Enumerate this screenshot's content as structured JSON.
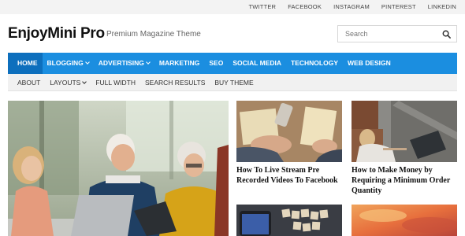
{
  "social_links": [
    "TWITTER",
    "FACEBOOK",
    "INSTAGRAM",
    "PINTEREST",
    "LINKEDIN"
  ],
  "site": {
    "title": "EnjoyMini Pro",
    "tagline": "Premium Magazine Theme"
  },
  "search": {
    "placeholder": "Search",
    "icon": "search-icon"
  },
  "main_nav": [
    {
      "label": "HOME",
      "active": true,
      "dropdown": false
    },
    {
      "label": "BLOGGING",
      "active": false,
      "dropdown": true
    },
    {
      "label": "ADVERTISING",
      "active": false,
      "dropdown": true
    },
    {
      "label": "MARKETING",
      "active": false,
      "dropdown": false
    },
    {
      "label": "SEO",
      "active": false,
      "dropdown": false
    },
    {
      "label": "SOCIAL MEDIA",
      "active": false,
      "dropdown": false
    },
    {
      "label": "TECHNOLOGY",
      "active": false,
      "dropdown": false
    },
    {
      "label": "WEB DESIGN",
      "active": false,
      "dropdown": false
    }
  ],
  "sub_nav": [
    {
      "label": "ABOUT",
      "dropdown": false
    },
    {
      "label": "LAYOUTS",
      "dropdown": true
    },
    {
      "label": "FULL WIDTH",
      "dropdown": false
    },
    {
      "label": "SEARCH RESULTS",
      "dropdown": false
    },
    {
      "label": "BUY THEME",
      "dropdown": false
    }
  ],
  "colors": {
    "nav_blue": "#1b8ee0",
    "nav_active": "#0d6fbd",
    "subnav_bg": "#f1f1f1",
    "topbar_bg": "#f3f3f3"
  },
  "posts": [
    {
      "title": "How To Live Stream Pre Recorded Videos To Facebook"
    },
    {
      "title": "How to Make Money by Requiring a Minimum Order Quantity"
    },
    {
      "title": ""
    },
    {
      "title": ""
    }
  ]
}
